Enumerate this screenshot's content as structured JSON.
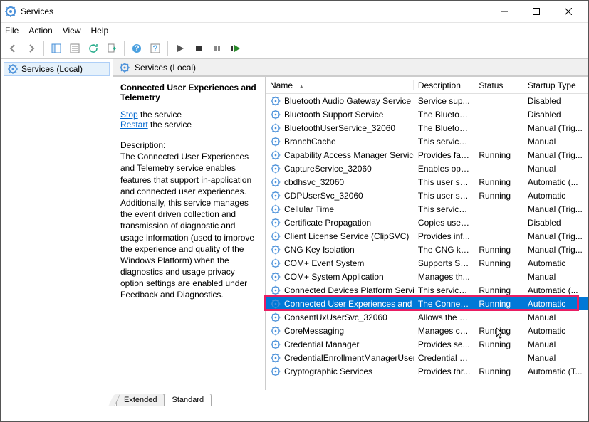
{
  "app": {
    "title": "Services"
  },
  "menu": {
    "file": "File",
    "action": "Action",
    "view": "View",
    "help": "Help"
  },
  "tree": {
    "root": "Services (Local)"
  },
  "main_header": {
    "label": "Services (Local)"
  },
  "detail": {
    "title": "Connected User Experiences and Telemetry",
    "stop": "Stop",
    "stop_suffix": " the service",
    "restart": "Restart",
    "restart_suffix": " the service",
    "desc_label": "Description:",
    "desc": "The Connected User Experiences and Telemetry service enables features that support in-application and connected user experiences. Additionally, this service manages the event driven collection and transmission of diagnostic and usage information (used to improve the experience and quality of the Windows Platform) when the diagnostics and usage privacy option settings are enabled under Feedback and Diagnostics."
  },
  "columns": {
    "name": "Name",
    "desc": "Description",
    "status": "Status",
    "startup": "Startup Type"
  },
  "tabs": {
    "extended": "Extended",
    "standard": "Standard"
  },
  "services": [
    {
      "name": "Bluetooth Audio Gateway Service",
      "desc": "Service sup...",
      "status": "",
      "startup": "Disabled"
    },
    {
      "name": "Bluetooth Support Service",
      "desc": "The Bluetoo...",
      "status": "",
      "startup": "Disabled"
    },
    {
      "name": "BluetoothUserService_32060",
      "desc": "The Bluetoo...",
      "status": "",
      "startup": "Manual (Trig..."
    },
    {
      "name": "BranchCache",
      "desc": "This service ...",
      "status": "",
      "startup": "Manual"
    },
    {
      "name": "Capability Access Manager Service",
      "desc": "Provides fac...",
      "status": "Running",
      "startup": "Manual (Trig..."
    },
    {
      "name": "CaptureService_32060",
      "desc": "Enables opti...",
      "status": "",
      "startup": "Manual"
    },
    {
      "name": "cbdhsvc_32060",
      "desc": "This user ser...",
      "status": "Running",
      "startup": "Automatic (..."
    },
    {
      "name": "CDPUserSvc_32060",
      "desc": "This user ser...",
      "status": "Running",
      "startup": "Automatic"
    },
    {
      "name": "Cellular Time",
      "desc": "This service ...",
      "status": "",
      "startup": "Manual (Trig..."
    },
    {
      "name": "Certificate Propagation",
      "desc": "Copies user ...",
      "status": "",
      "startup": "Disabled"
    },
    {
      "name": "Client License Service (ClipSVC)",
      "desc": "Provides inf...",
      "status": "",
      "startup": "Manual (Trig..."
    },
    {
      "name": "CNG Key Isolation",
      "desc": "The CNG ke...",
      "status": "Running",
      "startup": "Manual (Trig..."
    },
    {
      "name": "COM+ Event System",
      "desc": "Supports Sy...",
      "status": "Running",
      "startup": "Automatic"
    },
    {
      "name": "COM+ System Application",
      "desc": "Manages th...",
      "status": "",
      "startup": "Manual"
    },
    {
      "name": "Connected Devices Platform Service",
      "desc": "This service ...",
      "status": "Running",
      "startup": "Automatic (..."
    },
    {
      "name": "Connected User Experiences and Tele...",
      "desc": "The Connec...",
      "status": "Running",
      "startup": "Automatic",
      "selected": true
    },
    {
      "name": "ConsentUxUserSvc_32060",
      "desc": "Allows the s...",
      "status": "",
      "startup": "Manual"
    },
    {
      "name": "CoreMessaging",
      "desc": "Manages co...",
      "status": "Running",
      "startup": "Automatic"
    },
    {
      "name": "Credential Manager",
      "desc": "Provides se...",
      "status": "Running",
      "startup": "Manual"
    },
    {
      "name": "CredentialEnrollmentManagerUserSv...",
      "desc": "Credential E...",
      "status": "",
      "startup": "Manual"
    },
    {
      "name": "Cryptographic Services",
      "desc": "Provides thr...",
      "status": "Running",
      "startup": "Automatic (T..."
    }
  ]
}
